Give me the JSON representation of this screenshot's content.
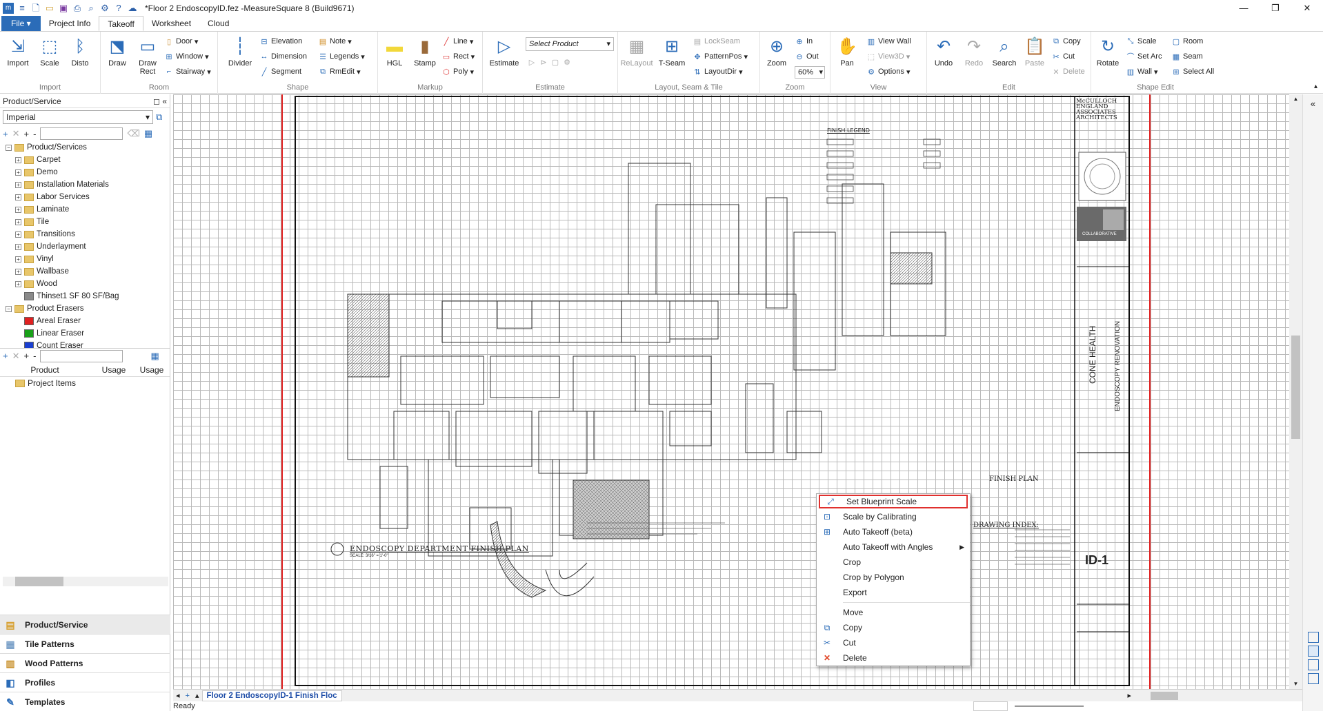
{
  "window": {
    "title": "*Floor 2 EndoscopyID.fez -MeasureSquare 8 (Build9671)",
    "controls": {
      "minimize": "—",
      "restore": "❐",
      "close": "✕"
    }
  },
  "tabs": [
    "Project Info",
    "Takeoff",
    "Worksheet",
    "Cloud"
  ],
  "file_tab": "File",
  "ribbon": {
    "import": {
      "label": "Import",
      "buttons": {
        "import": "Import",
        "scale": "Scale",
        "disto": "Disto"
      }
    },
    "room": {
      "label": "Room",
      "draw": "Draw",
      "draw_rect": "Draw\nRect",
      "door": "Door",
      "window": "Window",
      "stairway": "Stairway"
    },
    "shape": {
      "label": "Shape",
      "divider": "Divider",
      "elevation": "Elevation",
      "dimension": "Dimension",
      "segment": "Segment",
      "note": "Note",
      "legends": "Legends",
      "rmedit": "RmEdit"
    },
    "markup": {
      "label": "Markup",
      "hgl": "HGL",
      "stamp": "Stamp",
      "line": "Line",
      "rect": "Rect",
      "poly": "Poly"
    },
    "estimate": {
      "label": "Estimate",
      "estimate": "Estimate",
      "select_product": "Select Product"
    },
    "layout": {
      "label": "Layout, Seam & Tile",
      "relayout": "ReLayout",
      "tseam": "T-Seam",
      "lockseam": "LockSeam",
      "patternpos": "PatternPos",
      "layoutdir": "LayoutDir"
    },
    "zoom": {
      "label": "Zoom",
      "zoom": "Zoom",
      "in": "In",
      "out": "Out",
      "percent": "60%"
    },
    "view": {
      "label": "View",
      "pan": "Pan",
      "view_wall": "View Wall",
      "view3d": "View3D",
      "options": "Options"
    },
    "edit": {
      "label": "Edit",
      "undo": "Undo",
      "redo": "Redo",
      "search": "Search",
      "paste": "Paste",
      "copy": "Copy",
      "cut": "Cut",
      "delete": "Delete"
    },
    "shape_edit": {
      "label": "Shape Edit",
      "rotate": "Rotate",
      "scale": "Scale",
      "set_arc": "Set Arc",
      "wall": "Wall",
      "room": "Room",
      "seam": "Seam",
      "select_all": "Select All"
    }
  },
  "panel": {
    "title": "Product/Service",
    "unit": "Imperial",
    "tree": [
      {
        "label": "Product/Services",
        "level": 0,
        "type": "folder",
        "expanded": true
      },
      {
        "label": "Carpet",
        "level": 1,
        "type": "folder"
      },
      {
        "label": "Demo",
        "level": 1,
        "type": "folder"
      },
      {
        "label": "Installation Materials",
        "level": 1,
        "type": "folder"
      },
      {
        "label": "Labor Services",
        "level": 1,
        "type": "folder"
      },
      {
        "label": "Laminate",
        "level": 1,
        "type": "folder"
      },
      {
        "label": "Tile",
        "level": 1,
        "type": "folder"
      },
      {
        "label": "Transitions",
        "level": 1,
        "type": "folder"
      },
      {
        "label": "Underlayment",
        "level": 1,
        "type": "folder"
      },
      {
        "label": "Vinyl",
        "level": 1,
        "type": "folder"
      },
      {
        "label": "Wallbase",
        "level": 1,
        "type": "folder"
      },
      {
        "label": "Wood",
        "level": 1,
        "type": "folder"
      },
      {
        "label": "Thinset1  SF 80 SF/Bag",
        "level": 1,
        "type": "swatch",
        "color": "#8a8a8a"
      },
      {
        "label": "Product Erasers",
        "level": 0,
        "type": "folder",
        "expanded": true
      },
      {
        "label": "Areal Eraser",
        "level": 1,
        "type": "swatch",
        "color": "#e02020"
      },
      {
        "label": "Linear Eraser",
        "level": 1,
        "type": "swatch",
        "color": "#18a018"
      },
      {
        "label": "Count Eraser",
        "level": 1,
        "type": "swatch",
        "color": "#1a3fd0"
      }
    ],
    "columns": [
      "Product",
      "Usage",
      "Usage"
    ],
    "project_items": "Project Items"
  },
  "nav": [
    {
      "label": "Product/Service",
      "icon": "product-icon"
    },
    {
      "label": "Tile Patterns",
      "icon": "tile-icon"
    },
    {
      "label": "Wood Patterns",
      "icon": "wood-icon"
    },
    {
      "label": "Profiles",
      "icon": "profile-icon"
    },
    {
      "label": "Templates",
      "icon": "template-icon"
    }
  ],
  "drawing": {
    "plan_title": "ENDOSCOPY  DEPARTMENT  FINISH  PLAN",
    "scale_note": "SCALE: 3/16\" = 1'-0\"",
    "finish_legend": "FINISH  LEGEND",
    "firm": "McCULLOCH\nENGLAND\nASSOCIATES\nARCHITECTS",
    "collab": "COLLABORATIVE",
    "client": "CONE HEALTH",
    "project": "ENDOSCOPY RENOVATION",
    "sheet": "ID-1",
    "drawing_index": "DRAWING  INDEX:",
    "finish_plan_label": "FINISH  PLAN"
  },
  "sheet_tab": "Floor 2 EndoscopyID-1 Finish Floc",
  "status": "Ready",
  "context_menu": [
    {
      "label": "Set Blueprint Scale",
      "icon": "blueprint-scale-icon",
      "highlight": true
    },
    {
      "label": "Scale by Calibrating",
      "icon": "calibrate-icon"
    },
    {
      "label": "Auto Takeoff (beta)",
      "icon": "auto-takeoff-icon"
    },
    {
      "label": "Auto Takeoff with Angles",
      "icon": "",
      "submenu": true
    },
    {
      "label": "Crop",
      "icon": ""
    },
    {
      "label": "Crop by Polygon",
      "icon": ""
    },
    {
      "label": "Export",
      "icon": ""
    },
    {
      "separator": true
    },
    {
      "label": "Move",
      "icon": ""
    },
    {
      "label": "Copy",
      "icon": "copy-icon"
    },
    {
      "label": "Cut",
      "icon": "cut-icon"
    },
    {
      "label": "Delete",
      "icon": "delete-icon"
    }
  ]
}
